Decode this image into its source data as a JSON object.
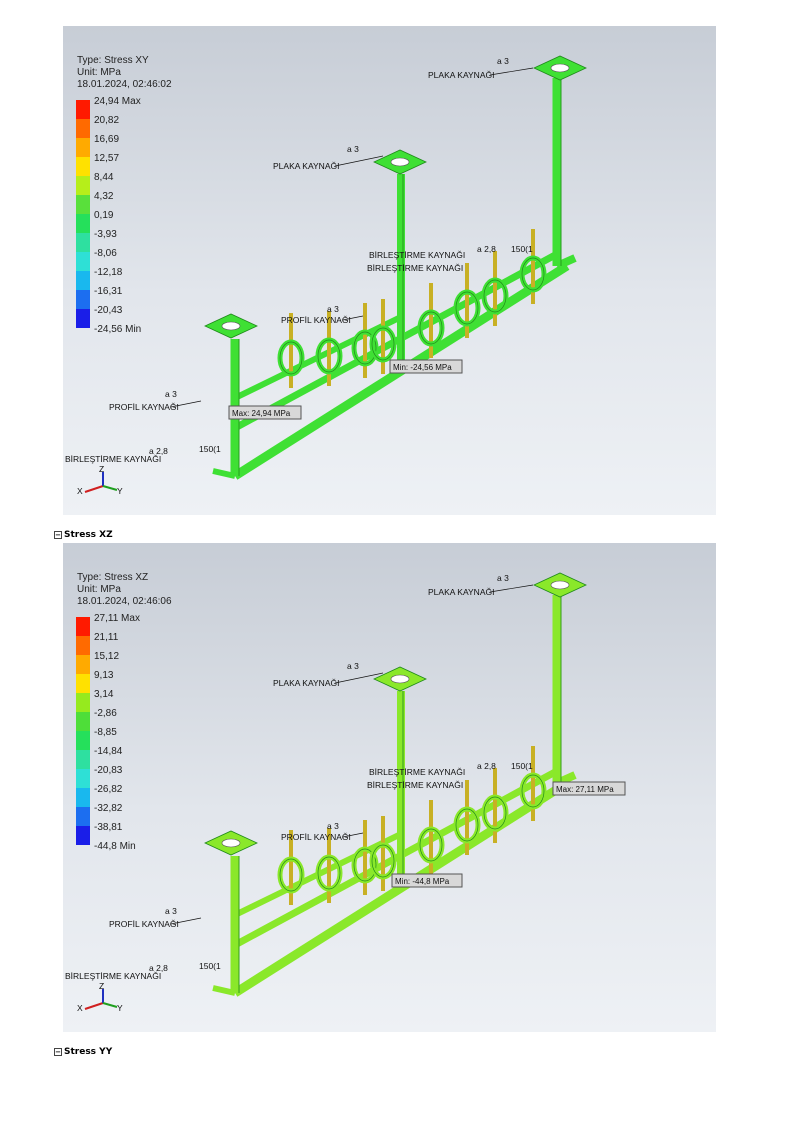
{
  "panels": [
    {
      "type_line": "Type: Stress XY",
      "unit_line": "Unit: MPa",
      "date_line": "18.01.2024, 02:46:02",
      "max_label": "24,94 Max",
      "ticks": [
        "20,82",
        "16,69",
        "12,57",
        "8,44",
        "4,32",
        "0,19",
        "-3,93",
        "-8,06",
        "-12,18",
        "-16,31",
        "-20,43",
        "-24,56 Min"
      ],
      "colors": [
        "#ff1a00",
        "#ff6a00",
        "#ffaa00",
        "#ffe100",
        "#b6ee1a",
        "#59e03b",
        "#25e05b",
        "#2ee0a0",
        "#2ee0d6",
        "#19b8ee",
        "#1c6ef0",
        "#1a1ee8"
      ],
      "min_tag": "Min: -24,56 MPa",
      "max_tag": "Max: 24,94 MPa",
      "frame_color": "#3fe034"
    },
    {
      "type_line": "Type: Stress XZ",
      "unit_line": "Unit: MPa",
      "date_line": "18.01.2024, 02:46:06",
      "max_label": "27,11 Max",
      "ticks": [
        "21,11",
        "15,12",
        "9,13",
        "3,14",
        "-2,86",
        "-8,85",
        "-14,84",
        "-20,83",
        "-26,82",
        "-32,82",
        "-38,81",
        "-44,8 Min"
      ],
      "colors": [
        "#ff1a00",
        "#ff6a00",
        "#ffaa00",
        "#ffe100",
        "#96ea1e",
        "#4ede39",
        "#25e05b",
        "#2ee0a0",
        "#2ee0d6",
        "#19b8ee",
        "#1c6ef0",
        "#1a1ee8"
      ],
      "min_tag": "Min: -44,8 MPa",
      "max_tag": "Max: 27,11 MPa",
      "frame_color": "#8ae82a"
    }
  ],
  "welds": {
    "plaka": "PLAKA KAYNAĞI",
    "profil": "PROFİL KAYNAĞI",
    "birlestirme": "BİRLEŞTİRME KAYNAĞI",
    "a3": "a 3",
    "a28": "a 2,8",
    "len": "150(1"
  },
  "sections": {
    "s1": "Stress XZ",
    "s2": "Stress YY"
  },
  "axis": {
    "x": "X",
    "z": "Z",
    "y": "Y"
  }
}
